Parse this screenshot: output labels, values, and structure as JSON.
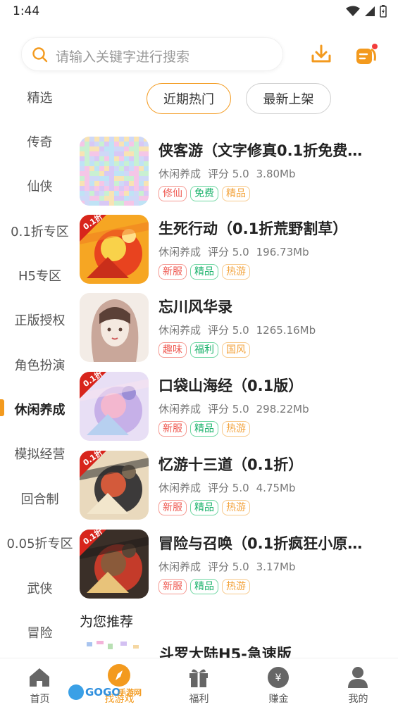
{
  "status": {
    "time": "1:44"
  },
  "search": {
    "placeholder": "请输入关键字进行搜索"
  },
  "categories": [
    {
      "label": "精选"
    },
    {
      "label": "传奇"
    },
    {
      "label": "仙侠"
    },
    {
      "label": "0.1折专区"
    },
    {
      "label": "H5专区"
    },
    {
      "label": "正版授权"
    },
    {
      "label": "角色扮演"
    },
    {
      "label": "休闲养成",
      "active": true
    },
    {
      "label": "模拟经营"
    },
    {
      "label": "回合制"
    },
    {
      "label": "0.05折专区"
    },
    {
      "label": "武侠"
    },
    {
      "label": "冒险"
    }
  ],
  "tabs": [
    {
      "label": "近期热门",
      "active": true
    },
    {
      "label": "最新上架",
      "active": false
    }
  ],
  "games": [
    {
      "title": "侠客游（文字修真0.1折免费…",
      "genre": "休闲养成",
      "rating": "评分 5.0",
      "size": "3.80Mb",
      "tags": [
        {
          "text": "修仙",
          "color": "red"
        },
        {
          "text": "免费",
          "color": "green"
        },
        {
          "text": "精品",
          "color": "orange"
        }
      ]
    },
    {
      "title": "生死行动（0.1折荒野割草）",
      "genre": "休闲养成",
      "rating": "评分 5.0",
      "size": "196.73Mb",
      "tags": [
        {
          "text": "新服",
          "color": "red"
        },
        {
          "text": "精品",
          "color": "green"
        },
        {
          "text": "热游",
          "color": "orange"
        }
      ]
    },
    {
      "title": "忘川风华录",
      "genre": "休闲养成",
      "rating": "评分 5.0",
      "size": "1265.16Mb",
      "tags": [
        {
          "text": "趣味",
          "color": "red"
        },
        {
          "text": "福利",
          "color": "green"
        },
        {
          "text": "国风",
          "color": "orange"
        }
      ]
    },
    {
      "title": "口袋山海经（0.1版）",
      "genre": "休闲养成",
      "rating": "评分 5.0",
      "size": "298.22Mb",
      "tags": [
        {
          "text": "新服",
          "color": "red"
        },
        {
          "text": "精品",
          "color": "green"
        },
        {
          "text": "热游",
          "color": "orange"
        }
      ]
    },
    {
      "title": "忆游十三道（0.1折）",
      "genre": "休闲养成",
      "rating": "评分 5.0",
      "size": "4.75Mb",
      "tags": [
        {
          "text": "新服",
          "color": "red"
        },
        {
          "text": "精品",
          "color": "green"
        },
        {
          "text": "热游",
          "color": "orange"
        }
      ]
    },
    {
      "title": "冒险与召唤（0.1折疯狂小原…",
      "genre": "休闲养成",
      "rating": "评分 5.0",
      "size": "3.17Mb",
      "tags": [
        {
          "text": "新服",
          "color": "red"
        },
        {
          "text": "精品",
          "color": "green"
        },
        {
          "text": "热游",
          "color": "orange"
        }
      ]
    }
  ],
  "recommend": {
    "title": "为您推荐",
    "partial_game": "斗罗大陆H5-急速版"
  },
  "thumb_badge": "0.1折",
  "bottom_nav": [
    {
      "label": "首页"
    },
    {
      "label": "找游戏",
      "active": true
    },
    {
      "label": "福利"
    },
    {
      "label": "赚金"
    },
    {
      "label": "我的"
    }
  ],
  "watermark": "GOGO手游网",
  "colors": {
    "accent": "#f39a1e",
    "tag_red": "#ef5a52",
    "tag_green": "#1bb26b",
    "tag_orange": "#f3a23a"
  }
}
